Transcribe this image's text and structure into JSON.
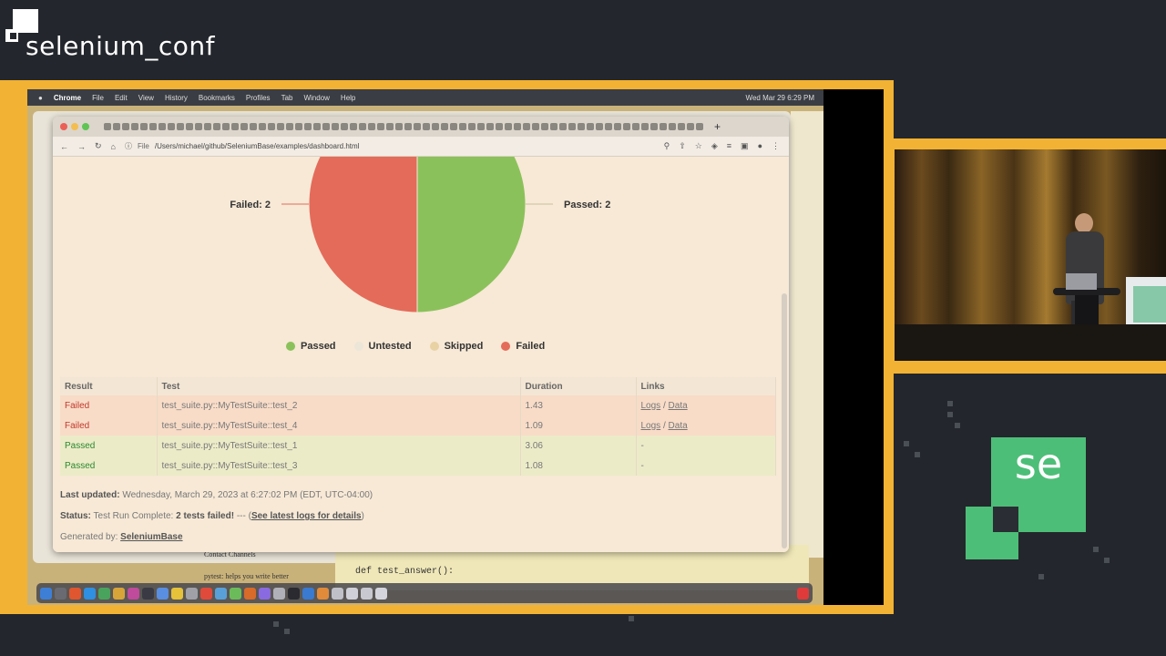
{
  "conference": {
    "name": "selenium_conf",
    "logo_text": "se"
  },
  "menubar": {
    "apple": "",
    "app": "Chrome",
    "items": [
      "File",
      "Edit",
      "View",
      "History",
      "Bookmarks",
      "Profiles",
      "Tab",
      "Window",
      "Help"
    ],
    "datetime": "Wed Mar 29  6:29 PM"
  },
  "browser": {
    "scheme_label": "File",
    "url": "/Users/michael/github/SeleniumBase/examples/dashboard.html"
  },
  "chart_data": {
    "type": "pie",
    "slices": [
      {
        "label": "Failed",
        "value": 2,
        "color": "#e46b5a"
      },
      {
        "label": "Passed",
        "value": 2,
        "color": "#8bc15a"
      }
    ],
    "slice_labels": [
      "Failed: 2",
      "Passed: 2"
    ],
    "legend": [
      {
        "label": "Passed",
        "color": "#8bc15a"
      },
      {
        "label": "Untested",
        "color": "#ece6d8"
      },
      {
        "label": "Skipped",
        "color": "#e8d2a4"
      },
      {
        "label": "Failed",
        "color": "#e46b5a"
      }
    ]
  },
  "table": {
    "headers": [
      "Result",
      "Test",
      "Duration",
      "Links"
    ],
    "rows": [
      {
        "result": "Failed",
        "test": "test_suite.py::MyTestSuite::test_2",
        "duration": "1.43",
        "logs": "Logs",
        "sep": " / ",
        "data": "Data"
      },
      {
        "result": "Failed",
        "test": "test_suite.py::MyTestSuite::test_4",
        "duration": "1.09",
        "logs": "Logs",
        "sep": " / ",
        "data": "Data"
      },
      {
        "result": "Passed",
        "test": "test_suite.py::MyTestSuite::test_1",
        "duration": "3.06",
        "links": "-"
      },
      {
        "result": "Passed",
        "test": "test_suite.py::MyTestSuite::test_3",
        "duration": "1.08",
        "links": "-"
      }
    ]
  },
  "footer": {
    "updated_label": "Last updated:",
    "updated_value": "Wednesday, March 29, 2023 at 6:27:02 PM (EDT, UTC-04:00)",
    "status_label": "Status:",
    "status_prefix": "Test Run Complete:",
    "status_bold": "2 tests failed!",
    "status_sep": " --- (",
    "status_link": "See latest logs for details",
    "status_end": ")",
    "generated_label": "Generated by:",
    "generated_link": "SeleniumBase"
  },
  "background": {
    "code": "def test_answer():",
    "doc_line1": "Contact Channels",
    "doc_line2": "pytest: helps you write better"
  }
}
